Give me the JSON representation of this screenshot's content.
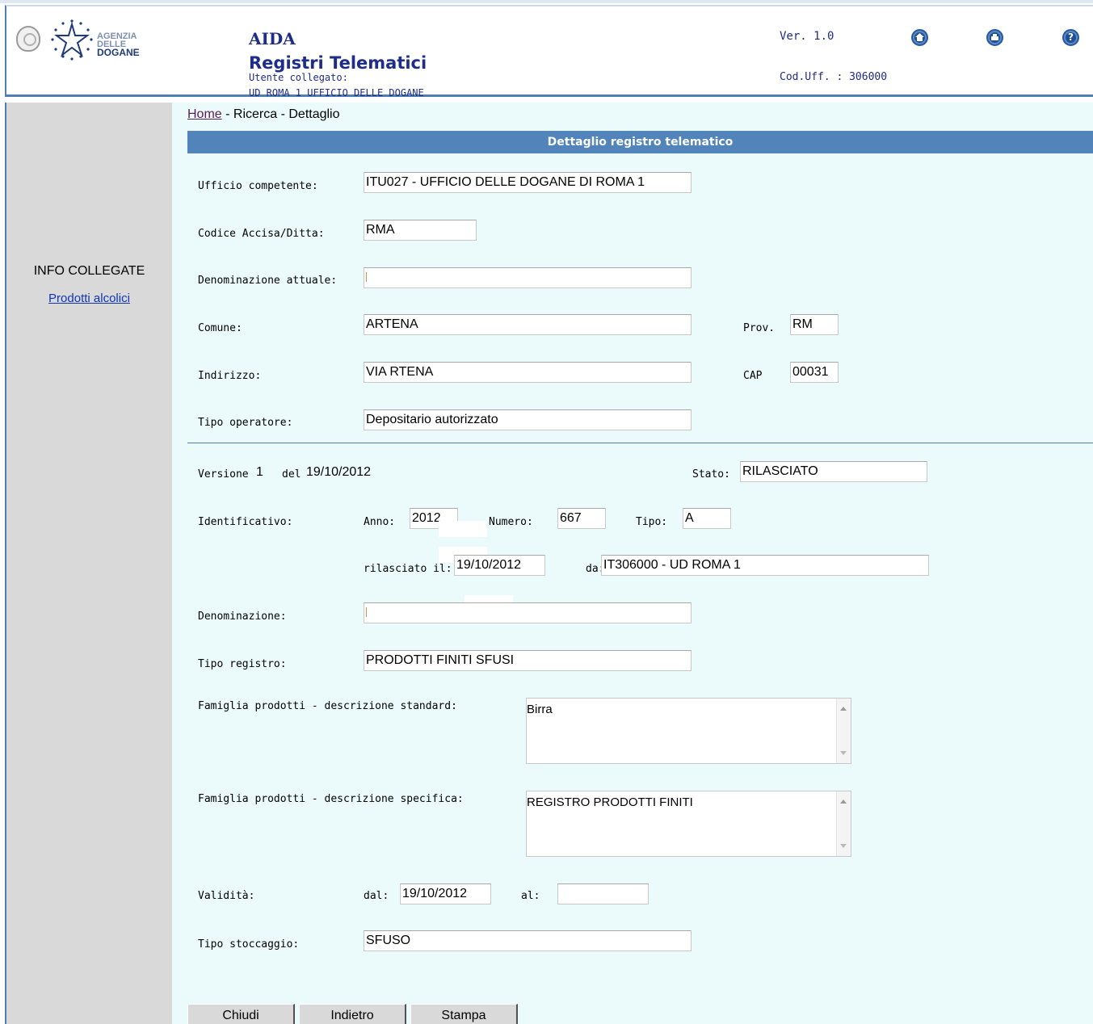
{
  "header": {
    "logo_text": [
      "AGENZIA",
      "DELLE",
      "DOGANE"
    ],
    "app_title": "AIDA",
    "app_subtitle": "Registri Telematici",
    "user_label": "Utente collegato:",
    "user_value": "UD ROMA 1 UFFICIO DELLE DOGANE",
    "version": "Ver. 1.0",
    "office_code": "Cod.Uff. : 306000",
    "icons": [
      "home-icon",
      "print-icon",
      "help-icon"
    ]
  },
  "sidebar": {
    "title": "INFO COLLEGATE",
    "link": "Prodotti alcolici"
  },
  "breadcrumb": {
    "home": "Home",
    "rest": " - Ricerca - Dettaglio"
  },
  "section_title": "Dettaglio registro telematico",
  "form": {
    "ufficio": {
      "label": "Ufficio competente:",
      "value": "ITU027 - UFFICIO DELLE DOGANE DI ROMA 1"
    },
    "codice": {
      "label": "Codice Accisa/Ditta:",
      "value": "RMA"
    },
    "denominazione_attuale": {
      "label": "Denominazione attuale:",
      "value": ""
    },
    "comune": {
      "label": "Comune:",
      "value": "ARTENA"
    },
    "prov": {
      "label": "Prov.",
      "value": "RM"
    },
    "indirizzo": {
      "label": "Indirizzo:",
      "value": "VIA RTENA"
    },
    "cap": {
      "label": "CAP",
      "value": "00031"
    },
    "tipo_operatore": {
      "label": "Tipo operatore:",
      "value": "Depositario autorizzato"
    }
  },
  "version": {
    "label": "Versione",
    "number": "1",
    "del_label": "del",
    "date": "19/10/2012",
    "stato_label": "Stato:",
    "stato": "RILASCIATO"
  },
  "identificativo": {
    "label": "Identificativo:",
    "anno_label": "Anno:",
    "anno": "2012",
    "numero_label": "Numero:",
    "numero": "667",
    "tipo_label": "Tipo:",
    "tipo": "A",
    "rilasciato_label": "rilasciato il:",
    "rilasciato": "19/10/2012",
    "da_label": "da:",
    "da": "IT306000 - UD ROMA 1"
  },
  "denominazione": {
    "label": "Denominazione:",
    "value": ""
  },
  "tipo_registro": {
    "label": "Tipo registro:",
    "value": "PRODOTTI FINITI SFUSI"
  },
  "famiglia_standard": {
    "label": "Famiglia prodotti - descrizione standard:",
    "value": "Birra"
  },
  "famiglia_specifica": {
    "label": "Famiglia prodotti - descrizione specifica:",
    "value": "REGISTRO PRODOTTI FINITI"
  },
  "validita": {
    "label": "Validità:",
    "dal_label": "dal:",
    "dal": "19/10/2012",
    "al_label": "al:",
    "al": ""
  },
  "tipo_stoccaggio": {
    "label": "Tipo stoccaggio:",
    "value": "SFUSO"
  },
  "buttons": {
    "chiudi": "Chiudi",
    "indietro": "Indietro",
    "stampa": "Stampa"
  }
}
